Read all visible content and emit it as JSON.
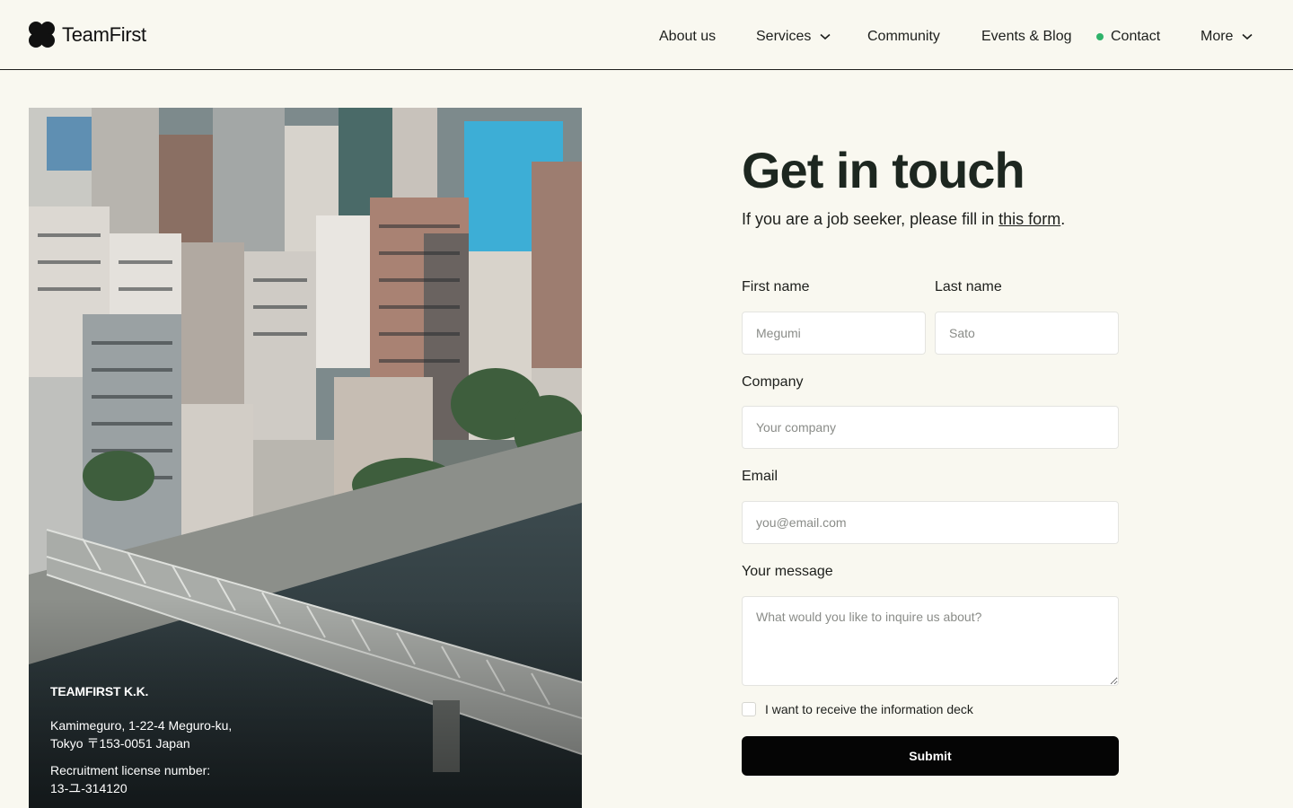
{
  "brand": {
    "name": "TeamFirst"
  },
  "nav": {
    "about": "About us",
    "services": "Services",
    "community": "Community",
    "events": "Events & Blog",
    "contact": "Contact",
    "more": "More"
  },
  "office": {
    "company": "TEAMFIRST K.K.",
    "address_line1": "Kamimeguro, 1-22-4 Meguro-ku,",
    "address_line2": "Tokyo 〒153-0051 Japan",
    "license_label": "Recruitment license number:",
    "license_number": "13-ユ-314120"
  },
  "form": {
    "title": "Get in touch",
    "subtitle_prefix": "If you are a job seeker, please fill in ",
    "subtitle_link": "this form",
    "subtitle_suffix": ".",
    "first_name_label": "First name",
    "first_name_placeholder": "Megumi",
    "last_name_label": "Last name",
    "last_name_placeholder": "Sato",
    "company_label": "Company",
    "company_placeholder": "Your company",
    "email_label": "Email",
    "email_placeholder": "you@email.com",
    "message_label": "Your message",
    "message_placeholder": "What would you like to inquire us about?",
    "checkbox_label": "I want to receive the information deck",
    "submit_label": "Submit"
  },
  "colors": {
    "background": "#f9f8f0",
    "contact_dot": "#2fb36a",
    "button": "#050505"
  }
}
